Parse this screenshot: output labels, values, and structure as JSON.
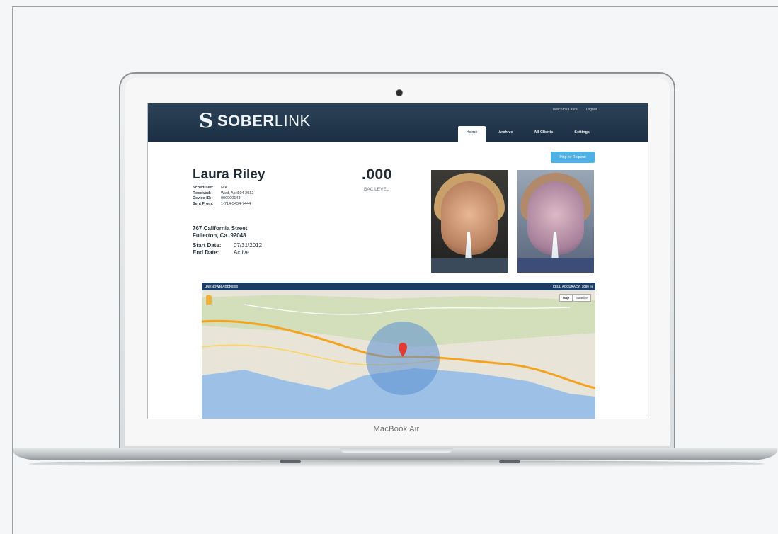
{
  "device": {
    "label": "MacBook Air"
  },
  "app": {
    "brand": {
      "mark": "S",
      "name_bold": "SOBER",
      "name_light": "LINK"
    },
    "header": {
      "welcome": "Welcome Laura",
      "logout": "Logout"
    },
    "tabs": [
      {
        "label": "Home",
        "active": true
      },
      {
        "label": "Archive",
        "active": false
      },
      {
        "label": "All Clients",
        "active": false
      },
      {
        "label": "Settings",
        "active": false
      }
    ],
    "ping_button": "Ping for Request"
  },
  "client": {
    "name": "Laura Riley",
    "details": [
      {
        "key": "Scheduled:",
        "value": "N/A"
      },
      {
        "key": "Received:",
        "value": "Wed, April 04 2012"
      },
      {
        "key": "Device ID:",
        "value": "000000143"
      },
      {
        "key": "Sent From:",
        "value": "1-714-5454-7444"
      }
    ],
    "address_line1": "767 California Street",
    "address_line2": "Fullerton, Ca. 92048",
    "dates": [
      {
        "key": "Start Date:",
        "value": "07/31/2012"
      },
      {
        "key": "End Date:",
        "value": "Active"
      }
    ]
  },
  "reading": {
    "bac_value": ".000",
    "bac_label": "BAC LEVEL"
  },
  "map": {
    "left_label": "UNKNOWN ADDRESS",
    "right_label": "CELL ACCURACY: 3000 m",
    "toggle": [
      "Map",
      "Satellite"
    ]
  },
  "colors": {
    "header": "#1c2f44",
    "accent": "#4fb1e3",
    "map_bar": "#1d3c63"
  }
}
